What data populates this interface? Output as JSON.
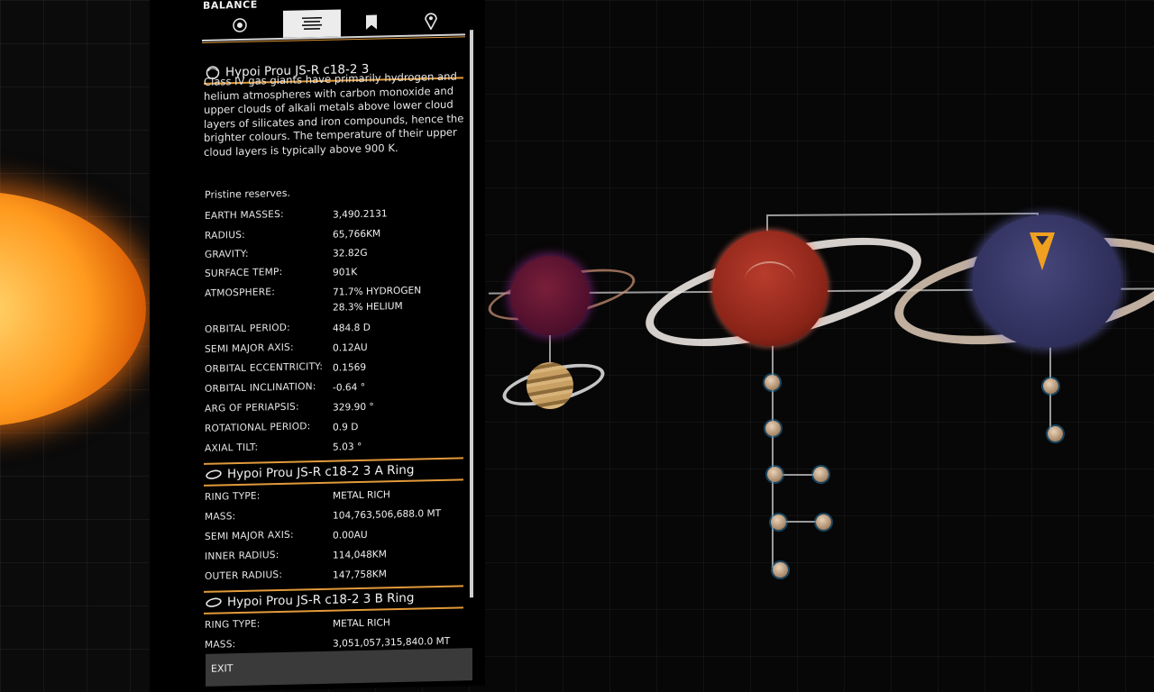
{
  "panel": {
    "title": "BALANCE",
    "tabs": [
      {
        "name": "system-map-icon"
      },
      {
        "name": "list-icon"
      },
      {
        "name": "bookmark-icon"
      },
      {
        "name": "navigation-marker-icon"
      }
    ],
    "body": {
      "name": "Hypoi Prou JS-R c18-2 3",
      "description": "Class IV gas giants have primarily hydrogen and helium atmospheres with carbon monoxide and upper clouds of alkali metals above lower cloud layers of silicates and iron compounds, hence the brighter colours. The temperature of their upper cloud layers is typically above 900 K.",
      "reserves": "Pristine reserves.",
      "stats": [
        {
          "key": "EARTH MASSES:",
          "value": "3,490.2131"
        },
        {
          "key": "RADIUS:",
          "value": "65,766KM"
        },
        {
          "key": "GRAVITY:",
          "value": "32.82G"
        },
        {
          "key": "SURFACE TEMP:",
          "value": "901K"
        },
        {
          "key": "ATMOSPHERE:",
          "value": "71.7% HYDROGEN",
          "value2": "28.3% HELIUM"
        },
        {
          "key": "ORBITAL PERIOD:",
          "value": "484.8 D"
        },
        {
          "key": "SEMI MAJOR AXIS:",
          "value": "0.12AU"
        },
        {
          "key": "ORBITAL ECCENTRICITY:",
          "value": "0.1569"
        },
        {
          "key": "ORBITAL INCLINATION:",
          "value": "-0.64 °"
        },
        {
          "key": "ARG OF PERIAPSIS:",
          "value": "329.90 °"
        },
        {
          "key": "ROTATIONAL PERIOD:",
          "value": "0.9 D"
        },
        {
          "key": "AXIAL TILT:",
          "value": "5.03 °"
        }
      ]
    },
    "rings": [
      {
        "name": "Hypoi Prou JS-R c18-2 3 A Ring",
        "stats": [
          {
            "key": "RING TYPE:",
            "value": "METAL RICH"
          },
          {
            "key": "MASS:",
            "value": "104,763,506,688.0 MT"
          },
          {
            "key": "SEMI MAJOR AXIS:",
            "value": "0.00AU"
          },
          {
            "key": "INNER RADIUS:",
            "value": "114,048KM"
          },
          {
            "key": "OUTER RADIUS:",
            "value": "147,758KM"
          }
        ]
      },
      {
        "name": "Hypoi Prou JS-R c18-2 3 B Ring",
        "stats": [
          {
            "key": "RING TYPE:",
            "value": "METAL RICH"
          },
          {
            "key": "MASS:",
            "value": "3,051,057,315,840.0 MT"
          }
        ]
      }
    ],
    "exit_label": "EXIT"
  },
  "colors": {
    "accent": "#e29a3a",
    "selection_marker": "#f0a020",
    "panel_bg": "#000000",
    "text": "#e8e8e8"
  }
}
